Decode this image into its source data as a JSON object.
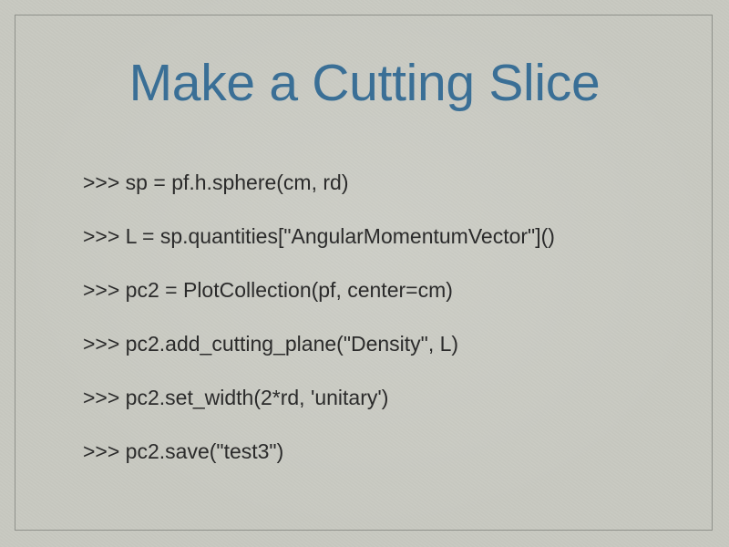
{
  "slide": {
    "title": "Make a Cutting Slice",
    "code_lines": [
      ">>> sp = pf.h.sphere(cm, rd)",
      ">>> L = sp.quantities[\"AngularMomentumVector\"]()",
      ">>> pc2 = PlotCollection(pf, center=cm)",
      ">>> pc2.add_cutting_plane(\"Density\", L)",
      ">>> pc2.set_width(2*rd, 'unitary')",
      ">>> pc2.save(\"test3\")"
    ]
  },
  "colors": {
    "background": "#c8c9c1",
    "title": "#3a6f96",
    "text": "#2b2b2b",
    "frame": "#8f918b"
  }
}
